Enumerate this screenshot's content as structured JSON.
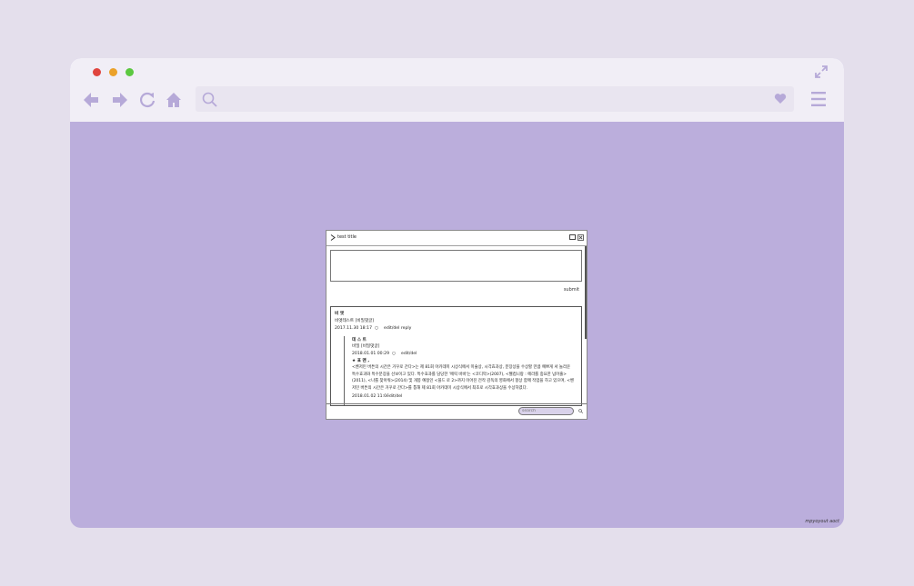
{
  "browser": {
    "accent_color": "#bbaedc",
    "toolbar_icons": [
      "back-arrow-icon",
      "forward-arrow-icon",
      "reload-icon",
      "home-icon",
      "search-icon",
      "heart-icon",
      "hamburger-menu-icon",
      "expand-icon"
    ],
    "watermark": "mpyoyout aoct"
  },
  "dialog": {
    "title": "test title",
    "textarea_value": "",
    "submit_label": "submit",
    "comments": [
      {
        "author": "비 엣",
        "text": "비엣테스트 [비밀댓글]",
        "date": "2017.11.30 18:17",
        "actions": "edit/del   reply",
        "replies": [
          {
            "author": "데 스 트",
            "text": "비밀 [비밀댓글]",
            "date": "2018.01.01 00:29",
            "actions": "edit/del"
          },
          {
            "author": "★ 표 맨 ,",
            "text": "<벤저민 버튼의 시간은 거꾸로 간다>는 제 81회 아카데미 시상식에서 미술상, 시각효과상, 분장상을 수상할 만큼 예쁘게 서 놀라운 특수효과와 특수분장을 선보이고 있다. 특수효과를 담당한 '에릭 바바'는 <코디악>(2007), <웰컴니랑 : 에라를 중요한 넘어줄>(2011), <나를 찾아줘>(2014) 및 개봉 예정인 <블드 로 2>까지 이어진 전작 감독의 영화에서 항상 함께 작업을 하고 있으며, <벤저민 버튼의 시간은 거꾸로 간다>를 통해 제 81회 아카데미 시상식에서 최초로 시각효과상을 수상하였다.",
            "date": "2018.01.02 11:09",
            "actions": "edit/del"
          }
        ]
      }
    ],
    "search_placeholder": "search"
  }
}
